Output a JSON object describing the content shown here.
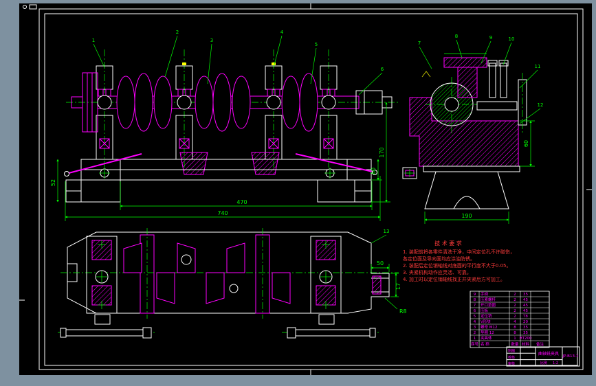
{
  "viewer": {
    "background_color": "#7e91a0",
    "canvas_color": "#000000"
  },
  "colors": {
    "geometry": "#ff00ff",
    "outline": "#ffffff",
    "dimension": "#00ff00",
    "notes": "#ff3b3b",
    "highlight": "#ffff00"
  },
  "dims": {
    "front_width": "470",
    "front_total_width": "740",
    "front_left_height": "52",
    "front_base_height": "60",
    "front_right_height": "170",
    "section_base_width": "190",
    "section_body_height": "60",
    "plan_tongue_width": "50",
    "plan_tongue_height": "17",
    "plan_radius": "R8"
  },
  "callouts": {
    "labels": [
      "1",
      "2",
      "3",
      "4",
      "5",
      "6",
      "7",
      "8",
      "9",
      "10",
      "11",
      "12",
      "13"
    ]
  },
  "notes": {
    "title": "技 术 要 求",
    "lines": [
      "1. 装配前将各零件清洗干净，中间定位孔不许碰伤，",
      "   各定位面及导向面均应涂油防锈。",
      "2. 装配后定位销轴线对底面的平行度不大于0.05。",
      "3. 夹紧机构动作应灵活、可靠。",
      "4. 加工时以定位销轴线找正并夹紧后方可加工。"
    ]
  },
  "bom": {
    "headers": [
      "序号",
      "名  称",
      "数量",
      "材料",
      "备注"
    ],
    "rows": [
      [
        "9",
        "手柄",
        "2",
        "35",
        ""
      ],
      [
        "8",
        "压紧螺杆",
        "2",
        "45",
        ""
      ],
      [
        "7",
        "开口垫圈",
        "2",
        "45",
        ""
      ],
      [
        "6",
        "压板",
        "2",
        "45",
        ""
      ],
      [
        "5",
        "定位销",
        "2",
        "T8",
        ""
      ],
      [
        "4",
        "V形块",
        "4",
        "20",
        ""
      ],
      [
        "3",
        "螺母 M12",
        "8",
        "35",
        ""
      ],
      [
        "2",
        "垫圈 12",
        "8",
        "35",
        ""
      ],
      [
        "1",
        "夹具体",
        "1",
        "HT200",
        ""
      ]
    ]
  },
  "title_block": {
    "role_labels": [
      "制图",
      "校核",
      "审核"
    ],
    "name": "曲轴铣夹具",
    "drawing_no": "JP-B13-1",
    "scale_label": "比例",
    "scale": "1:2"
  }
}
